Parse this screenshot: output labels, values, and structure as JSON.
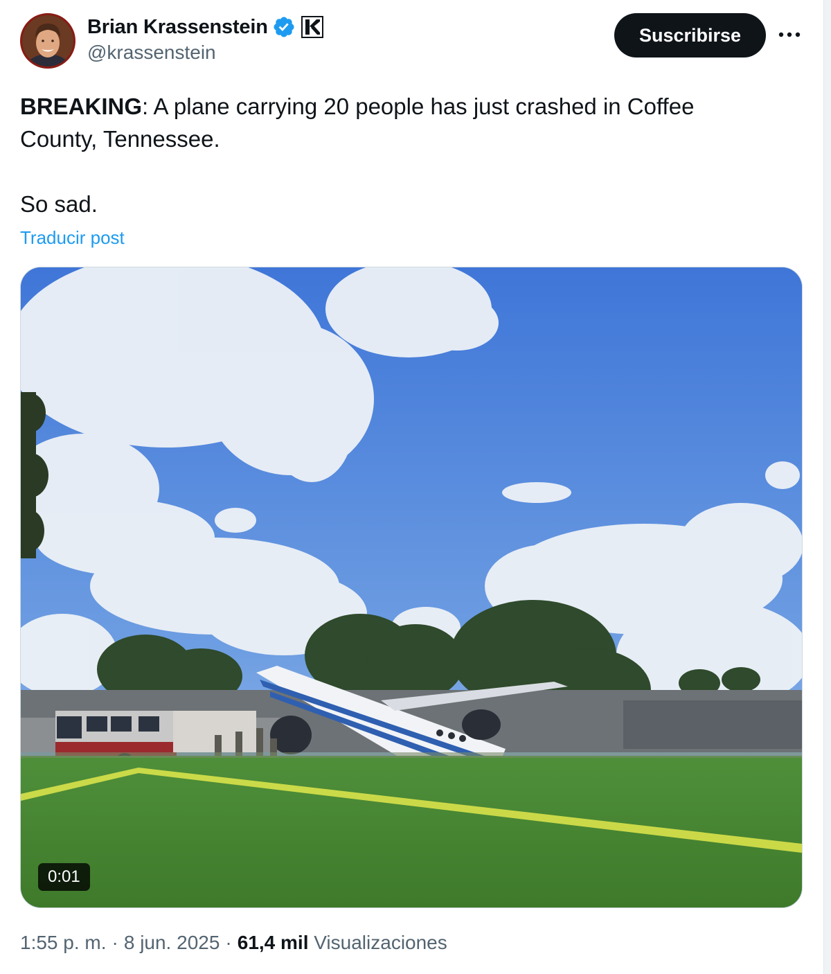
{
  "author": {
    "display_name": "Brian Krassenstein",
    "handle": "@krassenstein",
    "verified": true,
    "verified_color": "#1d9bf0",
    "affiliate_badge_icon": "k-logo-icon"
  },
  "header": {
    "subscribe_label": "Suscribirse",
    "more_icon": "more-horizontal-icon"
  },
  "post": {
    "breaking_label": "BREAKING",
    "text_line_1": ": A plane carrying 20 people has just crashed in Coffee",
    "text_line_2": "County, Tennessee.",
    "text_line_3": "So sad.",
    "translate_label": "Traducir post"
  },
  "media": {
    "type": "video",
    "timecode": "0:01"
  },
  "footer": {
    "time": "1:55 p. m.",
    "date": "8 jun. 2025",
    "views_count": "61,4 mil",
    "views_label": "Visualizaciones"
  },
  "colors": {
    "text": "#0f1419",
    "secondary": "#536471",
    "link": "#1d9bf0",
    "button_bg": "#0f1419"
  }
}
